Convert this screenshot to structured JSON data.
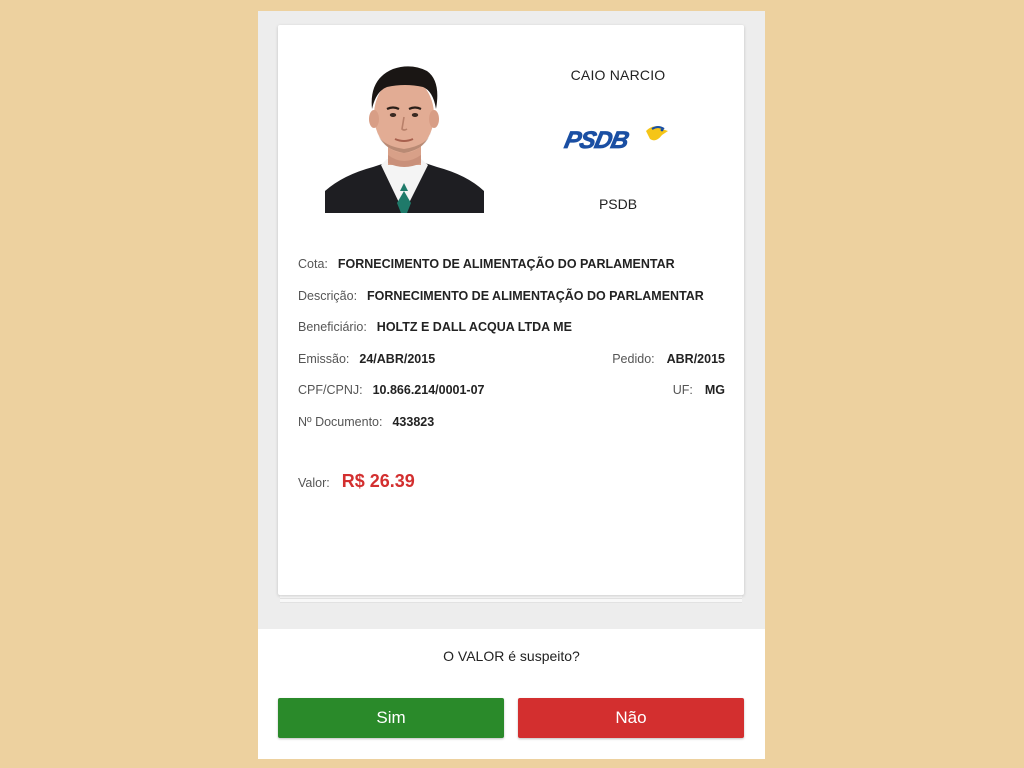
{
  "candidate": {
    "name": "CAIO NARCIO",
    "party": "PSDB",
    "logo_text": "PSDB"
  },
  "expense": {
    "cota_label": "Cota:",
    "cota_value": "FORNECIMENTO DE ALIMENTAÇÃO DO PARLAMENTAR",
    "descricao_label": "Descrição:",
    "descricao_value": "FORNECIMENTO DE ALIMENTAÇÃO DO PARLAMENTAR",
    "beneficiario_label": "Beneficiário:",
    "beneficiario_value": "HOLTZ E DALL ACQUA LTDA ME",
    "emissao_label": "Emissão:",
    "emissao_value": "24/ABR/2015",
    "pedido_label": "Pedido:",
    "pedido_value": "ABR/2015",
    "cpf_label": "CPF/CPNJ:",
    "cpf_value": "10.866.214/0001-07",
    "uf_label": "UF:",
    "uf_value": "MG",
    "documento_label": "Nº Documento:",
    "documento_value": "433823",
    "valor_label": "Valor:",
    "valor_value": "R$ 26.39"
  },
  "vote": {
    "question": "O VALOR é suspeito?",
    "yes_label": "Sim",
    "no_label": "Não"
  },
  "colors": {
    "background": "#EDD19F",
    "yes": "#2A8A2A",
    "no": "#D32F2F",
    "amount": "#D32F2F",
    "logo_blue": "#1A4FA3",
    "logo_yellow": "#F5C518"
  }
}
